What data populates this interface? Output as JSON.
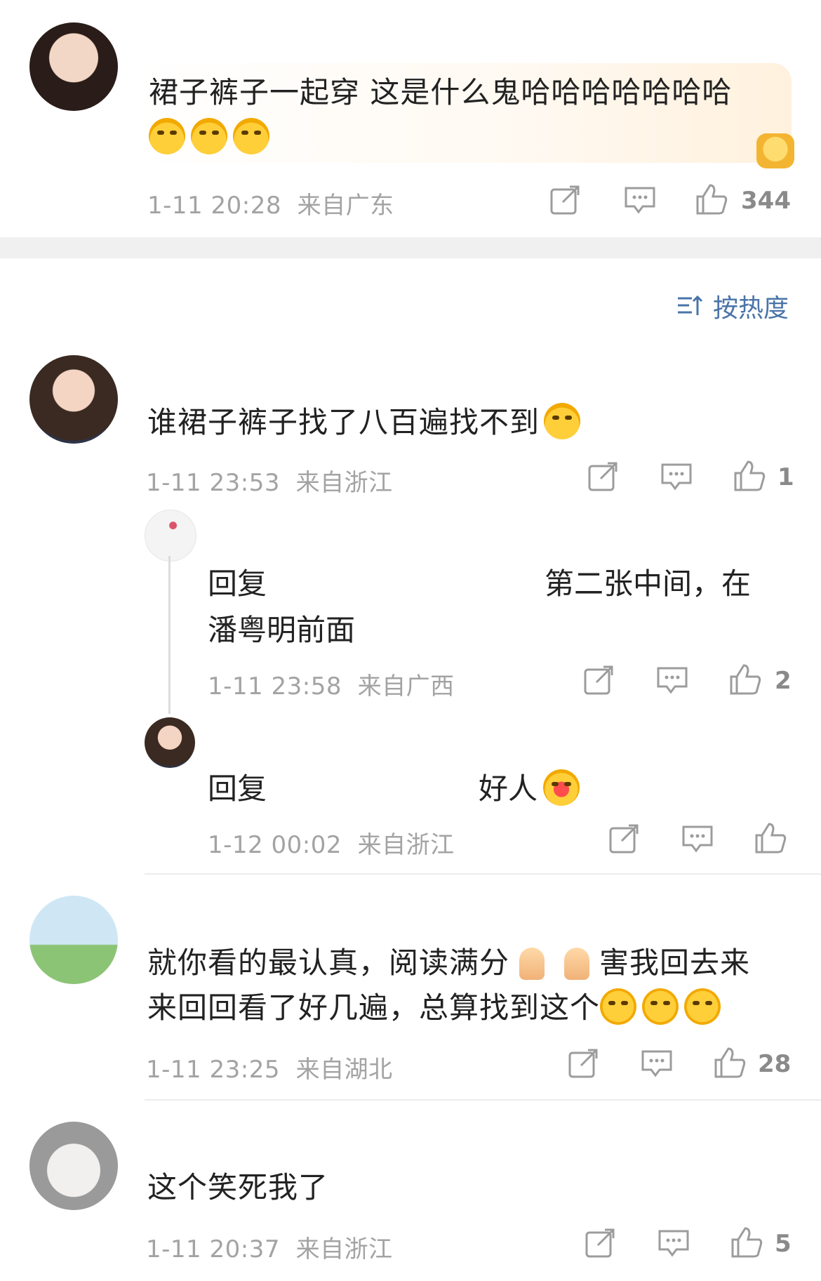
{
  "comments": [
    {
      "text": "裙子裤子一起穿 这是什么鬼哈哈哈哈哈哈哈",
      "emojis": [
        "laugh-cry",
        "laugh-cry",
        "laugh-cry"
      ],
      "time": "1-11 20:28",
      "location": "来自广东",
      "likes": "344"
    },
    {
      "text": "谁裙子裤子找了八百遍找不到",
      "emoji": "laugh-cry",
      "time": "1-11 23:53",
      "location": "来自浙江",
      "likes": "1",
      "replies": [
        {
          "prefix": "回复",
          "text": "第二张中间，在",
          "text2": "潘粤明前面",
          "time": "1-11 23:58",
          "location": "来自广西",
          "likes": "2"
        },
        {
          "prefix": "回复",
          "text": "好人",
          "emoji": "heart-hug",
          "time": "1-12 00:02",
          "location": "来自浙江",
          "likes": ""
        }
      ]
    },
    {
      "text_line1_a": "就你看的最认真，阅读满分",
      "text_line1_b": "害我回去来",
      "text_line2": "来回回看了好几遍，总算找到这个",
      "emojis": [
        "thumbs-up",
        "thumbs-up",
        "grin",
        "grin",
        "grin"
      ],
      "time": "1-11 23:25",
      "location": "来自湖北",
      "likes": "28"
    },
    {
      "text": "这个笑死我了",
      "time": "1-11 20:37",
      "location": "来自浙江",
      "likes": "5"
    }
  ],
  "sort": {
    "label": "按热度",
    "icon": "sort-icon"
  },
  "icons": [
    "share-icon",
    "comment-icon",
    "like-icon"
  ]
}
